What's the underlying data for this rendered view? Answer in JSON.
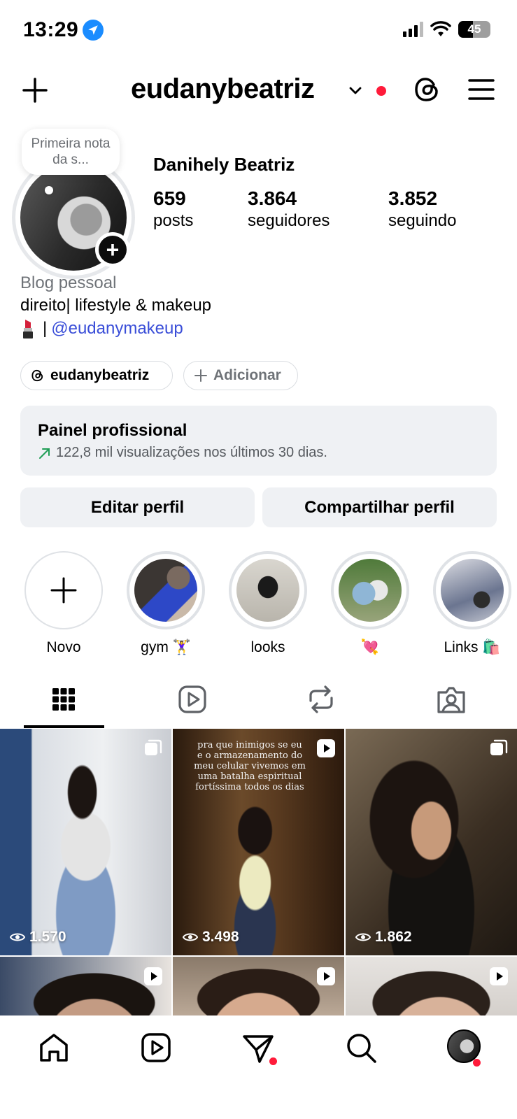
{
  "status_bar": {
    "time": "13:29",
    "battery": "45",
    "icons": [
      "location-arrow-icon",
      "cellular-signal-icon",
      "wifi-icon",
      "battery-icon"
    ]
  },
  "header": {
    "username": "eudanybeatriz",
    "icons": [
      "plus-icon",
      "chevron-down-icon",
      "threads-icon",
      "hamburger-menu-icon"
    ],
    "notification_dot_color": "#ff1b3a"
  },
  "profile": {
    "note": "Primeira nota da s...",
    "full_name": "Danihely Beatriz",
    "stats": [
      {
        "value": "659",
        "label": "posts"
      },
      {
        "value": "3.864",
        "label": "seguidores"
      },
      {
        "value": "3.852",
        "label": "seguindo"
      }
    ],
    "bio": {
      "category": "Blog pessoal",
      "line1": "direito| lifestyle & makeup",
      "separator": " | ",
      "link": "@eudanymakeup"
    },
    "chips": {
      "threads": "eudanybeatriz",
      "add": "Adicionar"
    }
  },
  "dashboard": {
    "title": "Painel profissional",
    "subtitle": "122,8 mil visualizações nos últimos 30 dias."
  },
  "buttons": {
    "edit": "Editar perfil",
    "share": "Compartilhar perfil"
  },
  "highlights": [
    {
      "label": "Novo"
    },
    {
      "label": "gym 🏋️‍♀️"
    },
    {
      "label": "looks"
    },
    {
      "label": "💘"
    },
    {
      "label": "Links 🛍️"
    }
  ],
  "tabs": [
    "grid-icon",
    "reels-icon",
    "reposts-icon",
    "tagged-icon"
  ],
  "posts": [
    {
      "views": "1.570",
      "type": "carousel"
    },
    {
      "views": "3.498",
      "type": "reel",
      "caption": "pra que inimigos se eu e o armazenamento do meu celular vivemos em uma batalha espiritual fortíssima todos os dias"
    },
    {
      "views": "1.862",
      "type": "carousel"
    }
  ],
  "colors": {
    "link": "#3a4ed8",
    "surface": "#eff1f4",
    "accent_red": "#ff1b3a"
  }
}
